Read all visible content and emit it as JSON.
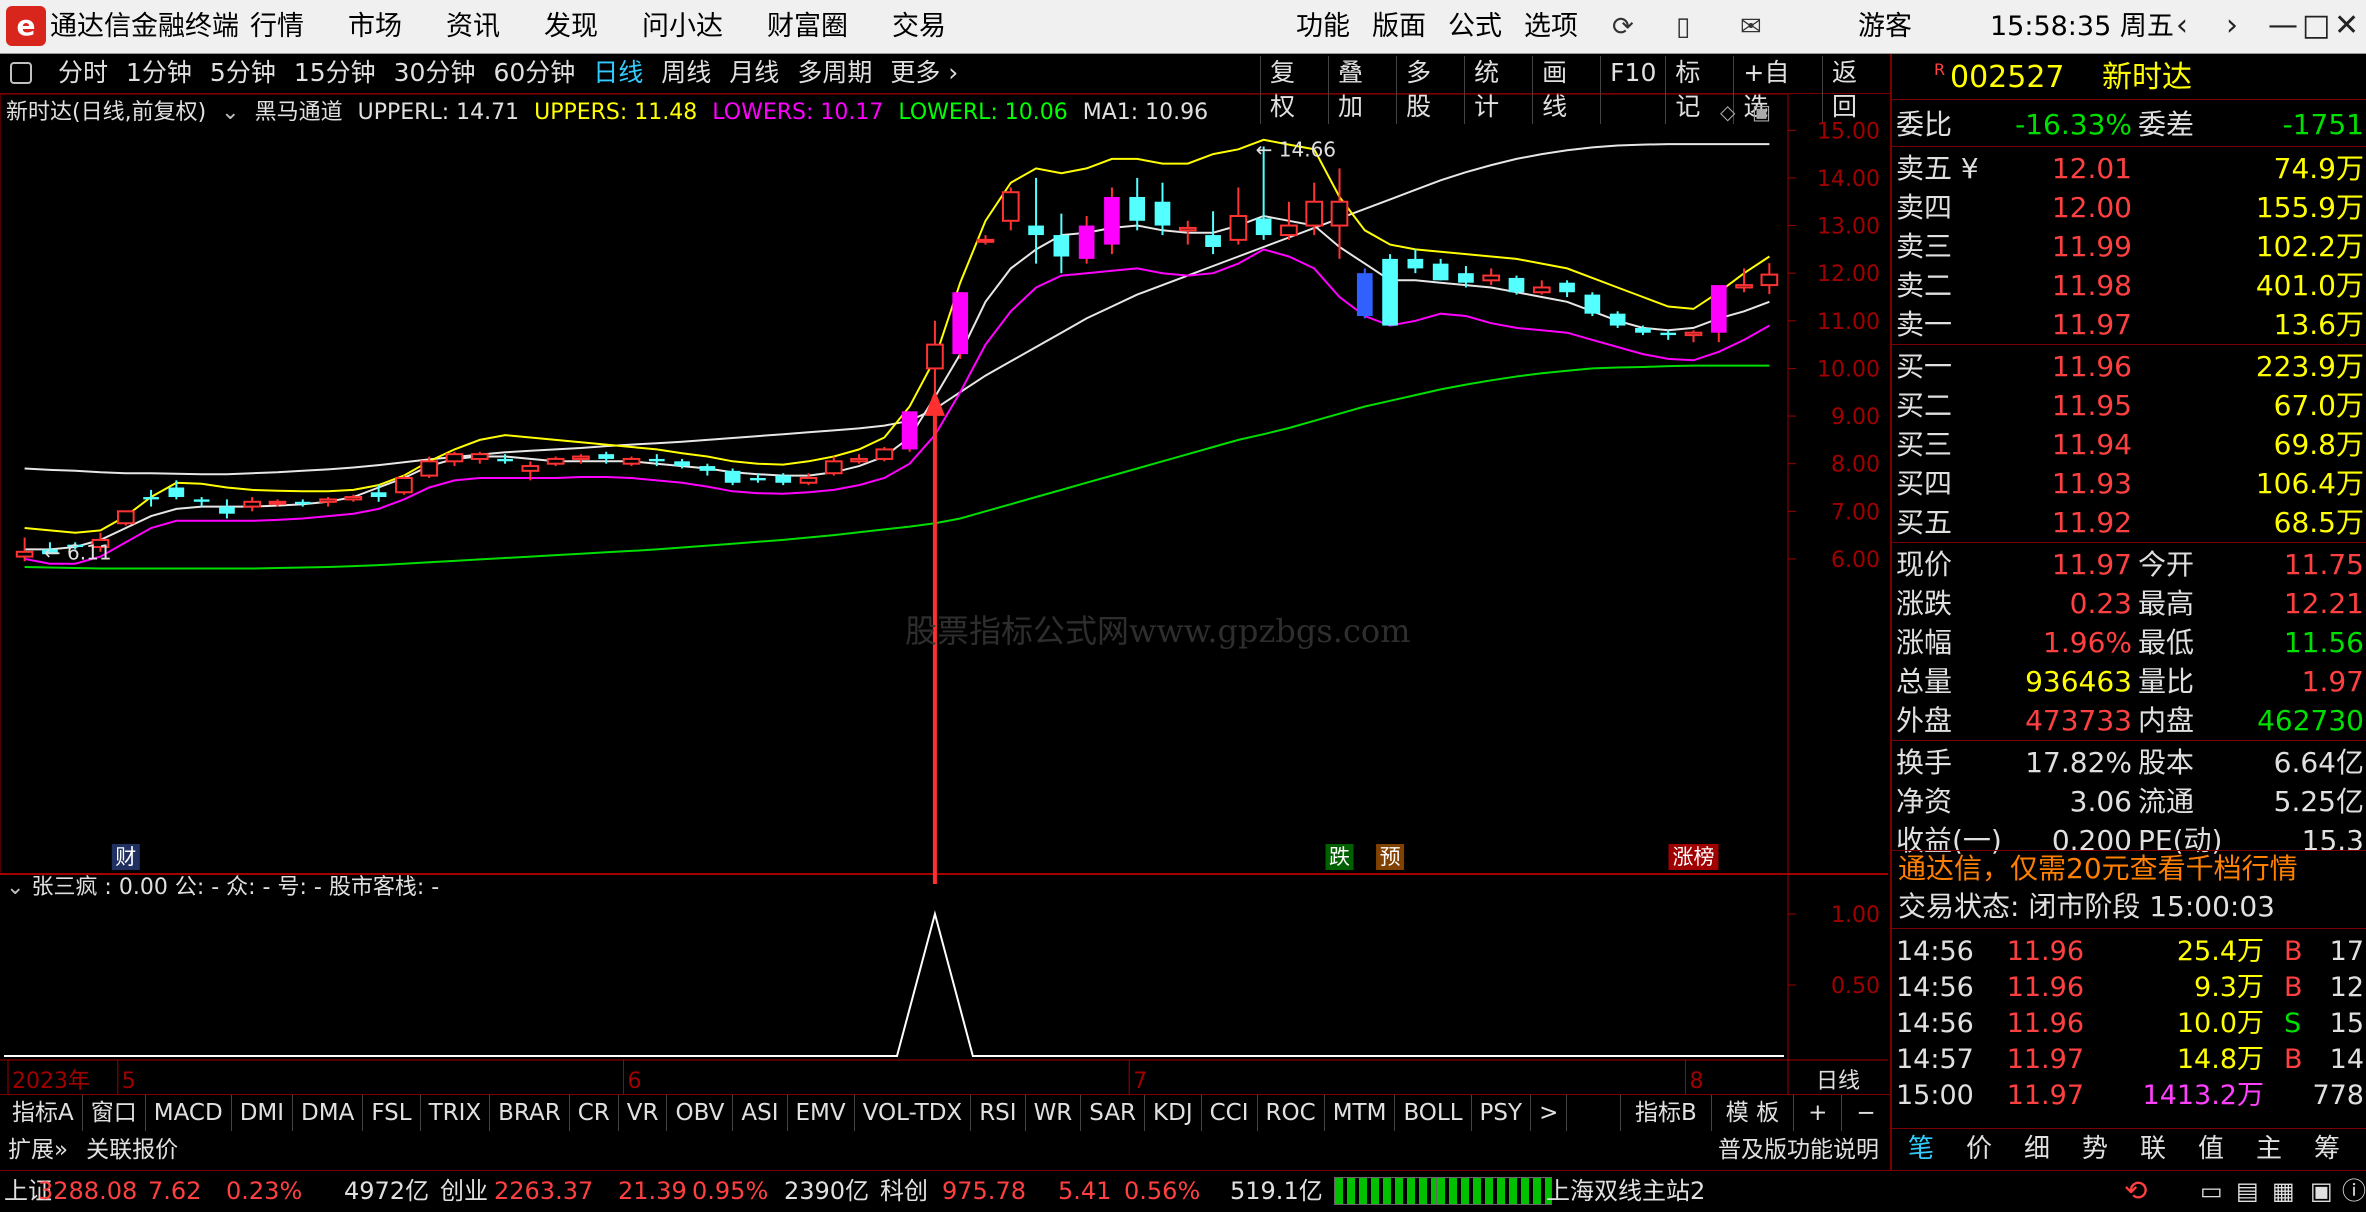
{
  "app": {
    "logo_glyph": "e",
    "title": "通达信金融终端",
    "menu_left": [
      "行情",
      "市场",
      "资讯",
      "发现",
      "问小达",
      "财富圈",
      "交易"
    ],
    "menu_right": [
      "功能",
      "版面",
      "公式",
      "选项"
    ],
    "user": "游客",
    "clock": "15:58:35 周五"
  },
  "toolbar": {
    "periods": [
      "分时",
      "1分钟",
      "5分钟",
      "15分钟",
      "30分钟",
      "60分钟",
      "日线",
      "周线",
      "月线",
      "多周期",
      "更多 ›"
    ],
    "active_period": "日线",
    "tools": [
      "复权",
      "叠加",
      "多股",
      "统计",
      "画线",
      "F10",
      "标记",
      "+自选",
      "返回"
    ]
  },
  "chart_header": {
    "stock": "新时达(日线,前复权)",
    "indicator": "黑马通道",
    "upperl": "UPPERL: 14.71",
    "uppers": "UPPERS: 11.48",
    "lowers": "LOWERS: 10.17",
    "lowerl": "LOWERL: 10.06",
    "ma1": "MA1: 10.96"
  },
  "sub_header": "张三疯 : 0.00  公: -  众: -  号: -  股市客栈: -",
  "watermark": "股票指标公式网www.gpzbgs.com",
  "colors": {
    "up": "#ff3333",
    "up_big": "#ff00ff",
    "down": "#54ffff",
    "upperl": "#e6e6e6",
    "uppers": "#ffff00",
    "lowers": "#ff00ff",
    "lowerl": "#00dd00",
    "axis_red": "#a00000",
    "arrow": "#ff3030"
  },
  "chart_data": {
    "type": "candlestick",
    "y_axis_ticks": [
      "15.00",
      "14.00",
      "13.00",
      "12.00",
      "11.00",
      "10.00",
      "9.00",
      "8.00",
      "7.00",
      "6.00"
    ],
    "ylim": [
      5.6,
      15.3
    ],
    "x_labels": [
      {
        "index": 0,
        "text": "2023年"
      },
      {
        "index": 4,
        "text": "5"
      },
      {
        "index": 24,
        "text": "6"
      },
      {
        "index": 44,
        "text": "7"
      },
      {
        "index": 66,
        "text": "8"
      }
    ],
    "period_label": "日线",
    "annotations": {
      "max": {
        "index": 49,
        "text": "14.66",
        "value": 14.66
      },
      "min": {
        "index": 1,
        "text": "6.11",
        "value": 6.11
      }
    },
    "markers": [
      {
        "index": 4,
        "text": "财",
        "bg": "#203060",
        "fg": "#ffffff"
      },
      {
        "index": 52,
        "text": "跌",
        "bg": "#006000",
        "fg": "#ffffff"
      },
      {
        "index": 54,
        "text": "预",
        "bg": "#804000",
        "fg": "#ffffff"
      },
      {
        "index": 66,
        "text": "涨榜",
        "bg": "#a00000",
        "fg": "#ffffff"
      }
    ],
    "signal_index": 36,
    "sub_axis_ticks": [
      "1.00",
      "0.50"
    ],
    "candles": [
      [
        6.05,
        6.45,
        6.15,
        5.95
      ],
      [
        6.2,
        6.35,
        6.1,
        6.11
      ],
      [
        6.3,
        6.35,
        6.25,
        6.2
      ],
      [
        6.25,
        6.55,
        6.4,
        6.15
      ],
      [
        6.75,
        6.95,
        7.0,
        6.7
      ],
      [
        7.3,
        7.45,
        7.25,
        7.1
      ],
      [
        7.5,
        7.65,
        7.3,
        7.25
      ],
      [
        7.25,
        7.3,
        7.2,
        7.1
      ],
      [
        7.1,
        7.25,
        6.95,
        6.85
      ],
      [
        7.1,
        7.3,
        7.2,
        7.0
      ],
      [
        7.2,
        7.25,
        7.2,
        7.1
      ],
      [
        7.2,
        7.25,
        7.15,
        7.1
      ],
      [
        7.2,
        7.3,
        7.25,
        7.1
      ],
      [
        7.25,
        7.35,
        7.3,
        7.2
      ],
      [
        7.4,
        7.55,
        7.3,
        7.2
      ],
      [
        7.4,
        7.75,
        7.7,
        7.35
      ],
      [
        7.75,
        8.15,
        8.05,
        7.7
      ],
      [
        8.05,
        8.25,
        8.2,
        7.95
      ],
      [
        8.1,
        8.25,
        8.2,
        8.0
      ],
      [
        8.1,
        8.2,
        8.05,
        8.0
      ],
      [
        7.85,
        8.05,
        7.95,
        7.65
      ],
      [
        8.0,
        8.15,
        8.1,
        7.95
      ],
      [
        8.1,
        8.2,
        8.15,
        8.0
      ],
      [
        8.2,
        8.25,
        8.1,
        8.0
      ],
      [
        8.0,
        8.15,
        8.1,
        7.95
      ],
      [
        8.1,
        8.2,
        8.05,
        7.95
      ],
      [
        8.05,
        8.1,
        7.95,
        7.9
      ],
      [
        7.95,
        8.0,
        7.85,
        7.75
      ],
      [
        7.85,
        7.9,
        7.6,
        7.55
      ],
      [
        7.7,
        7.8,
        7.65,
        7.6
      ],
      [
        7.75,
        7.8,
        7.6,
        7.55
      ],
      [
        7.6,
        7.8,
        7.7,
        7.55
      ],
      [
        7.8,
        8.15,
        8.05,
        7.75
      ],
      [
        8.05,
        8.2,
        8.1,
        8.0
      ],
      [
        8.1,
        8.35,
        8.3,
        8.05
      ],
      [
        8.3,
        9.1,
        9.1,
        8.25
      ],
      [
        10.0,
        11.0,
        10.5,
        9.5
      ],
      [
        10.3,
        11.6,
        11.6,
        10.2
      ],
      [
        12.7,
        12.8,
        12.7,
        12.6
      ],
      [
        13.1,
        13.8,
        13.7,
        12.9
      ],
      [
        13.0,
        14.0,
        12.8,
        12.2
      ],
      [
        12.8,
        13.25,
        12.35,
        12.0
      ],
      [
        12.3,
        13.2,
        13.0,
        12.2
      ],
      [
        12.6,
        13.8,
        13.6,
        12.4
      ],
      [
        13.6,
        14.0,
        13.1,
        12.9
      ],
      [
        13.5,
        13.9,
        13.0,
        12.8
      ],
      [
        12.9,
        13.1,
        12.95,
        12.6
      ],
      [
        12.8,
        13.3,
        12.55,
        12.4
      ],
      [
        12.7,
        13.8,
        13.2,
        12.6
      ],
      [
        13.15,
        14.66,
        12.8,
        12.7
      ],
      [
        12.8,
        13.5,
        13.0,
        12.7
      ],
      [
        13.0,
        13.9,
        13.5,
        12.8
      ],
      [
        13.0,
        14.2,
        13.5,
        12.3
      ],
      [
        12.0,
        12.1,
        11.1,
        11.05
      ],
      [
        12.3,
        12.4,
        10.9,
        10.9
      ],
      [
        12.3,
        12.5,
        12.1,
        12.0
      ],
      [
        12.2,
        12.3,
        11.85,
        11.85
      ],
      [
        12.0,
        12.15,
        11.8,
        11.7
      ],
      [
        11.85,
        12.1,
        11.95,
        11.75
      ],
      [
        11.9,
        11.95,
        11.6,
        11.55
      ],
      [
        11.6,
        11.85,
        11.7,
        11.55
      ],
      [
        11.8,
        11.85,
        11.6,
        11.5
      ],
      [
        11.55,
        11.6,
        11.15,
        11.1
      ],
      [
        11.15,
        11.2,
        10.9,
        10.85
      ],
      [
        10.85,
        10.9,
        10.75,
        10.7
      ],
      [
        10.75,
        10.8,
        10.7,
        10.6
      ],
      [
        10.7,
        10.8,
        10.75,
        10.55
      ],
      [
        10.75,
        11.75,
        11.75,
        10.55
      ],
      [
        11.7,
        12.1,
        11.75,
        11.6
      ],
      [
        11.75,
        12.21,
        11.97,
        11.56
      ]
    ],
    "series": [
      {
        "name": "UPPERL",
        "values": [
          7.9,
          7.87,
          7.85,
          7.82,
          7.8,
          7.8,
          7.79,
          7.78,
          7.78,
          7.8,
          7.82,
          7.85,
          7.88,
          7.92,
          7.97,
          8.03,
          8.09,
          8.14,
          8.19,
          8.24,
          8.27,
          8.3,
          8.33,
          8.37,
          8.4,
          8.43,
          8.46,
          8.5,
          8.54,
          8.58,
          8.62,
          8.66,
          8.7,
          8.74,
          8.8,
          8.9,
          9.15,
          9.5,
          9.85,
          10.15,
          10.45,
          10.75,
          11.05,
          11.3,
          11.55,
          11.75,
          11.95,
          12.15,
          12.35,
          12.55,
          12.75,
          12.95,
          13.15,
          13.35,
          13.55,
          13.75,
          13.95,
          14.12,
          14.27,
          14.4,
          14.5,
          14.58,
          14.64,
          14.68,
          14.7,
          14.71,
          14.71,
          14.71,
          14.71,
          14.71
        ]
      },
      {
        "name": "UPPERS",
        "values": [
          6.65,
          6.6,
          6.55,
          6.6,
          6.9,
          7.3,
          7.6,
          7.58,
          7.5,
          7.45,
          7.43,
          7.42,
          7.42,
          7.45,
          7.55,
          7.75,
          8.05,
          8.3,
          8.5,
          8.6,
          8.55,
          8.5,
          8.45,
          8.4,
          8.35,
          8.3,
          8.22,
          8.15,
          8.05,
          8.0,
          7.98,
          8.05,
          8.15,
          8.3,
          8.55,
          9.2,
          10.2,
          11.8,
          13.1,
          13.9,
          14.2,
          14.1,
          14.2,
          14.4,
          14.4,
          14.3,
          14.3,
          14.5,
          14.6,
          14.8,
          14.7,
          14.6,
          13.6,
          12.9,
          12.6,
          12.5,
          12.45,
          12.4,
          12.35,
          12.3,
          12.2,
          12.1,
          11.9,
          11.7,
          11.5,
          11.3,
          11.25,
          11.6,
          12.0,
          12.35
        ]
      },
      {
        "name": "MA1",
        "values": [
          6.2,
          6.2,
          6.25,
          6.4,
          6.65,
          6.9,
          7.05,
          7.1,
          7.1,
          7.1,
          7.12,
          7.15,
          7.2,
          7.3,
          7.5,
          7.7,
          7.95,
          8.1,
          8.15,
          8.15,
          8.1,
          8.05,
          8.05,
          8.05,
          8.05,
          8.0,
          7.95,
          7.9,
          7.82,
          7.78,
          7.75,
          7.75,
          7.82,
          7.95,
          8.15,
          8.55,
          9.4,
          10.3,
          11.4,
          12.1,
          12.5,
          12.8,
          12.85,
          12.95,
          13.0,
          12.9,
          12.85,
          12.85,
          13.0,
          13.2,
          13.1,
          13.0,
          12.55,
          12.2,
          11.85,
          11.85,
          11.8,
          11.75,
          11.7,
          11.6,
          11.5,
          11.4,
          11.2,
          11.0,
          10.85,
          10.8,
          10.85,
          11.05,
          11.2,
          11.4
        ]
      },
      {
        "name": "LOWERS",
        "values": [
          6.0,
          5.9,
          5.9,
          6.05,
          6.35,
          6.65,
          6.8,
          6.8,
          6.8,
          6.8,
          6.82,
          6.85,
          6.9,
          6.95,
          7.05,
          7.25,
          7.5,
          7.65,
          7.7,
          7.7,
          7.7,
          7.7,
          7.72,
          7.72,
          7.7,
          7.65,
          7.6,
          7.52,
          7.42,
          7.38,
          7.37,
          7.4,
          7.45,
          7.55,
          7.7,
          8.0,
          8.6,
          9.5,
          10.5,
          11.2,
          11.7,
          11.95,
          12.0,
          12.05,
          12.1,
          12.0,
          11.95,
          12.0,
          12.2,
          12.5,
          12.35,
          12.1,
          11.5,
          11.1,
          10.9,
          11.0,
          11.15,
          11.1,
          10.95,
          10.85,
          10.8,
          10.75,
          10.6,
          10.45,
          10.3,
          10.2,
          10.17,
          10.35,
          10.6,
          10.9
        ]
      },
      {
        "name": "LOWERL",
        "values": [
          5.83,
          5.82,
          5.81,
          5.8,
          5.8,
          5.8,
          5.8,
          5.8,
          5.8,
          5.8,
          5.81,
          5.82,
          5.83,
          5.85,
          5.87,
          5.9,
          5.93,
          5.96,
          5.99,
          6.02,
          6.05,
          6.08,
          6.11,
          6.14,
          6.17,
          6.2,
          6.24,
          6.28,
          6.32,
          6.36,
          6.4,
          6.45,
          6.5,
          6.56,
          6.62,
          6.68,
          6.75,
          6.85,
          7.0,
          7.15,
          7.3,
          7.45,
          7.6,
          7.75,
          7.9,
          8.05,
          8.2,
          8.35,
          8.5,
          8.62,
          8.75,
          8.9,
          9.05,
          9.2,
          9.32,
          9.44,
          9.56,
          9.66,
          9.75,
          9.83,
          9.9,
          9.95,
          10.0,
          10.02,
          10.03,
          10.05,
          10.06,
          10.06,
          10.06,
          10.06
        ]
      }
    ]
  },
  "tabs": {
    "left": [
      "指标A",
      "窗口",
      "MACD",
      "DMI",
      "DMA",
      "FSL",
      "TRIX",
      "BRAR",
      "CR",
      "VR",
      "OBV",
      "ASI",
      "EMV",
      "VOL-TDX",
      "RSI",
      "WR",
      "SAR",
      "KDJ",
      "CCI",
      "ROC",
      "MTM",
      "BOLL",
      "PSY",
      ">"
    ],
    "right": [
      "指标B",
      "模 板",
      "+",
      "−"
    ]
  },
  "ext_row": {
    "left": [
      "扩展»",
      "关联报价"
    ],
    "func": "普及版功能说明"
  },
  "statusbar": {
    "sh_name": "上证",
    "sh_val": "3288.08",
    "sh_chg": "7.62",
    "sh_pct": "0.23%",
    "sh_amt": "4972亿",
    "cy_name": "创业",
    "cy_val": "2263.37",
    "cy_chg": "21.39",
    "cy_pct": "0.95%",
    "cy_amt": "2390亿",
    "kc_name": "科创",
    "kc_val": "975.78",
    "kc_chg": "5.41",
    "kc_pct": "0.56%",
    "kc_amt": "519.1亿",
    "server": "上海双线主站2"
  },
  "panel": {
    "code": "002527",
    "name": "新时达",
    "r_mark": "R",
    "weibi_label": "委比",
    "weibi": "-16.33%",
    "weicha_label": "委差",
    "weicha": "-1751",
    "asks": [
      {
        "label": "卖五 ¥",
        "price": "12.01",
        "vol": "74.9万"
      },
      {
        "label": "卖四",
        "price": "12.00",
        "vol": "155.9万"
      },
      {
        "label": "卖三",
        "price": "11.99",
        "vol": "102.2万"
      },
      {
        "label": "卖二",
        "price": "11.98",
        "vol": "401.0万"
      },
      {
        "label": "卖一",
        "price": "11.97",
        "vol": "13.6万"
      }
    ],
    "bids": [
      {
        "label": "买一",
        "price": "11.96",
        "vol": "223.9万"
      },
      {
        "label": "买二",
        "price": "11.95",
        "vol": "67.0万"
      },
      {
        "label": "买三",
        "price": "11.94",
        "vol": "69.8万"
      },
      {
        "label": "买四",
        "price": "11.93",
        "vol": "106.4万"
      },
      {
        "label": "买五",
        "price": "11.92",
        "vol": "68.5万"
      }
    ],
    "stats1": [
      {
        "l1": "现价",
        "v1": "11.97",
        "c1": "red",
        "l2": "今开",
        "v2": "11.75",
        "c2": "red"
      },
      {
        "l1": "涨跌",
        "v1": "0.23",
        "c1": "red",
        "l2": "最高",
        "v2": "12.21",
        "c2": "red"
      },
      {
        "l1": "涨幅",
        "v1": "1.96%",
        "c1": "red",
        "l2": "最低",
        "v2": "11.56",
        "c2": "green"
      },
      {
        "l1": "总量",
        "v1": "936463",
        "c1": "yellow",
        "l2": "量比",
        "v2": "1.97",
        "c2": "red"
      },
      {
        "l1": "外盘",
        "v1": "473733",
        "c1": "red",
        "l2": "内盘",
        "v2": "462730",
        "c2": "green"
      }
    ],
    "stats2": [
      {
        "l1": "换手",
        "v1": "17.82%",
        "c1": "white",
        "l2": "股本",
        "v2": "6.64亿",
        "c2": "white"
      },
      {
        "l1": "净资",
        "v1": "3.06",
        "c1": "white",
        "l2": "流通",
        "v2": "5.25亿",
        "c2": "white"
      },
      {
        "l1": "收益(一)",
        "v1": "0.200",
        "c1": "white",
        "l2": "PE(动)",
        "v2": "15.3",
        "c2": "white"
      }
    ],
    "promo": "通达信，仅需20元查看千档行情",
    "trade_state": "交易状态: 闭市阶段 15:00:03",
    "ticks": [
      {
        "time": "14:56",
        "price": "11.96",
        "vol": "25.4万",
        "bs": "B",
        "n": "17",
        "vc": "yellow",
        "bc": "red"
      },
      {
        "time": "14:56",
        "price": "11.96",
        "vol": "9.3万",
        "bs": "B",
        "n": "12",
        "vc": "yellow",
        "bc": "red"
      },
      {
        "time": "14:56",
        "price": "11.96",
        "vol": "10.0万",
        "bs": "S",
        "n": "15",
        "vc": "yellow",
        "bc": "green"
      },
      {
        "time": "14:57",
        "price": "11.97",
        "vol": "14.8万",
        "bs": "B",
        "n": "14",
        "vc": "yellow",
        "bc": "red"
      },
      {
        "time": "15:00",
        "price": "11.97",
        "vol": "1413.2万",
        "bs": "",
        "n": "778",
        "vc": "magenta",
        "bc": "red"
      }
    ],
    "tabs": [
      "笔",
      "价",
      "细",
      "势",
      "联",
      "值",
      "主",
      "筹"
    ],
    "active_tab": "笔"
  }
}
